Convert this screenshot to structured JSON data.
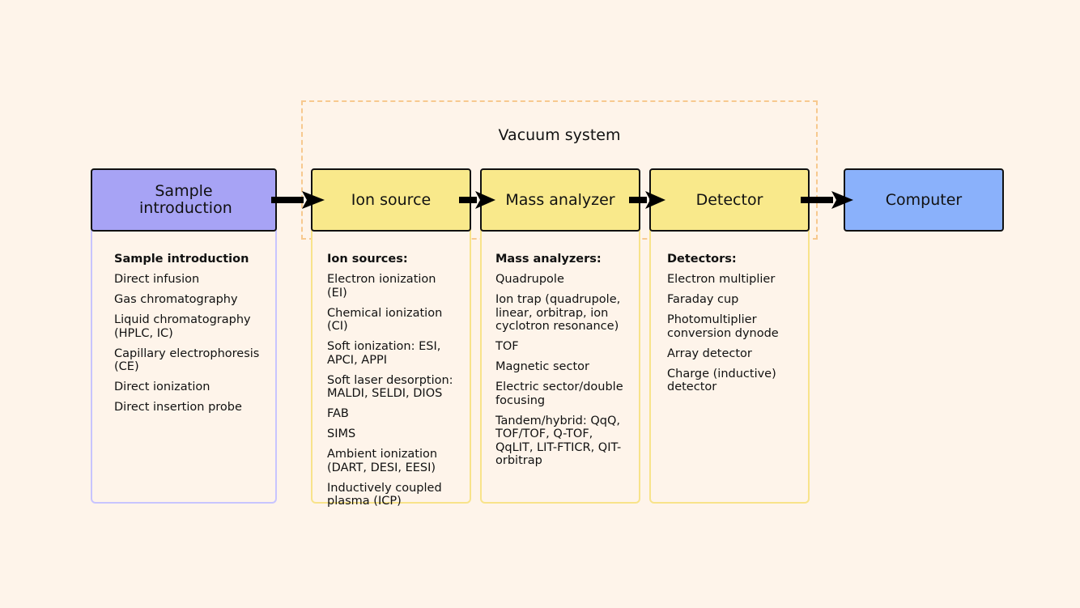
{
  "diagram": {
    "vacuum_label": "Vacuum system",
    "colors": {
      "background": "#fef4ea",
      "sample_box": "#a7a3f5",
      "stage_box": "#f9e98b",
      "computer_box": "#8ab1fb",
      "vacuum_border": "#f7c98f",
      "sample_panel_border": "#c8c4ff",
      "stage_panel_border": "#f8e38a"
    },
    "stages": [
      {
        "label": "Sample introduction",
        "list_title": "Sample introduction",
        "items": [
          "Direct infusion",
          "Gas chromatography",
          "Liquid chromatography (HPLC, IC)",
          "Capillary electrophoresis (CE)",
          "Direct ionization",
          "Direct insertion probe"
        ]
      },
      {
        "label": "Ion source",
        "list_title": "Ion sources:",
        "items": [
          "Electron ionization (EI)",
          "Chemical ionization (CI)",
          "Soft ionization: ESI, APCI, APPI",
          "Soft laser desorption: MALDI, SELDI, DIOS",
          "FAB",
          "SIMS",
          "Ambient ionization (DART, DESI, EESI)",
          "Inductively coupled plasma (ICP)"
        ]
      },
      {
        "label": "Mass analyzer",
        "list_title": "Mass analyzers:",
        "items": [
          "Quadrupole",
          "Ion trap (quadrupole, linear, orbitrap, ion cyclotron resonance)",
          "TOF",
          "Magnetic sector",
          "Electric sector/double focusing",
          "Tandem/hybrid: QqQ, TOF/TOF, Q-TOF, QqLIT, LIT-FTICR, QIT-orbitrap"
        ]
      },
      {
        "label": "Detector",
        "list_title": "Detectors:",
        "items": [
          "Electron multiplier",
          "Faraday cup",
          "Photomultiplier conversion dynode",
          "Array detector",
          "Charge (inductive) detector"
        ]
      },
      {
        "label": "Computer"
      }
    ]
  }
}
